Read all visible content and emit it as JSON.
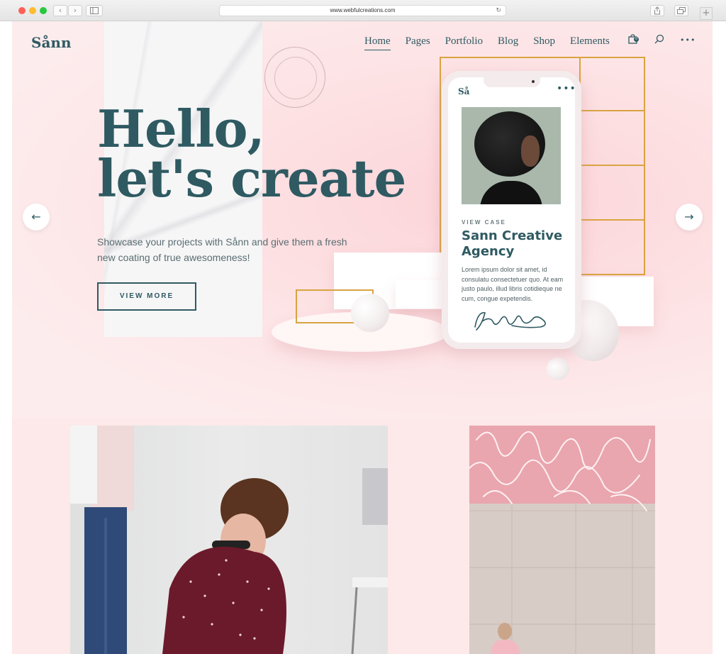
{
  "browser": {
    "url": "www.webfulcreations.com",
    "back_glyph": "‹",
    "forward_glyph": "›",
    "reload_glyph": "↻",
    "new_tab_glyph": "+"
  },
  "header": {
    "logo": "Sånn",
    "nav": [
      "Home",
      "Pages",
      "Portfolio",
      "Blog",
      "Shop",
      "Elements"
    ],
    "active_nav": "Home",
    "cart_count": "0",
    "cart_icon": "shopping-bag-icon",
    "search_icon": "search-icon",
    "menu_icon": "more-dots-icon",
    "menu_glyph": "•••"
  },
  "hero": {
    "title_line1": "Hello,",
    "title_line2": "let's create",
    "subtitle": "Showcase your projects with Sånn and give them a fresh new coating of true awesomeness!",
    "button_label": "VIEW MORE",
    "prev_glyph": "←",
    "next_glyph": "→"
  },
  "phone": {
    "logo": "Så",
    "dots": "•••",
    "carousel_dots": "• •",
    "view_case": "VIEW CASE",
    "title": "Sann Creative Agency",
    "text": "Lorem ipsum dolor sit amet, id consulatu consectetuer quo. At eam justo paulo, illud libris cotidieque ne cum, congue expetendis."
  },
  "colors": {
    "accent": "#2f5a62",
    "background": "#fde9ea",
    "gold": "#d9a441"
  }
}
